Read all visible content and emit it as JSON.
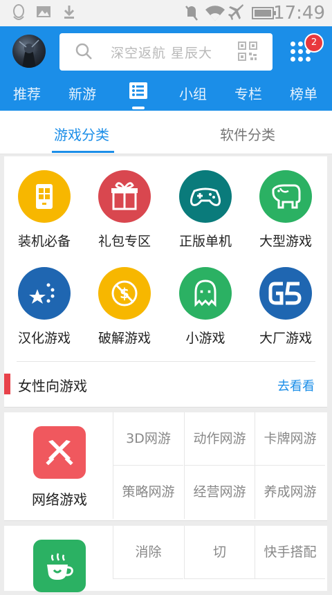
{
  "status_bar": {
    "time": "17:49",
    "icons": [
      "qq-icon",
      "image-icon",
      "download-icon",
      "mute-icon",
      "wifi-icon",
      "airplane-icon",
      "battery-icon"
    ]
  },
  "header": {
    "search_placeholder": "深空返航 星辰大",
    "notification_count": "2",
    "nav_tabs": [
      "推荐",
      "新游",
      "分类",
      "小组",
      "专栏",
      "榜单"
    ],
    "active_tab": "分类"
  },
  "sub_tabs": [
    "游戏分类",
    "软件分类"
  ],
  "categories": [
    {
      "label": "装机必备",
      "color": "#f7b700",
      "icon": "phone-grid-icon"
    },
    {
      "label": "礼包专区",
      "color": "#d9474f",
      "icon": "gift-icon"
    },
    {
      "label": "正版单机",
      "color": "#0a7b7b",
      "icon": "gamepad-icon"
    },
    {
      "label": "大型游戏",
      "color": "#2bb163",
      "icon": "elephant-icon"
    },
    {
      "label": "汉化游戏",
      "color": "#1f66b1",
      "icon": "stars-icon"
    },
    {
      "label": "破解游戏",
      "color": "#f7b700",
      "icon": "no-dollar-icon"
    },
    {
      "label": "小游戏",
      "color": "#2bb163",
      "icon": "ghost-icon"
    },
    {
      "label": "大厂游戏",
      "color": "#1f66b1",
      "icon": "g5-icon"
    }
  ],
  "female_section": {
    "label": "女性向游戏",
    "link": "去看看"
  },
  "online_games": {
    "label": "网络游戏",
    "color": "#f0585e",
    "subcategories": [
      "3D网游",
      "动作网游",
      "卡牌网游",
      "策略网游",
      "经营网游",
      "养成网游"
    ]
  },
  "casual_games": {
    "color": "#2bb163",
    "subcategories": [
      "消除",
      "切",
      "快手搭配"
    ]
  }
}
